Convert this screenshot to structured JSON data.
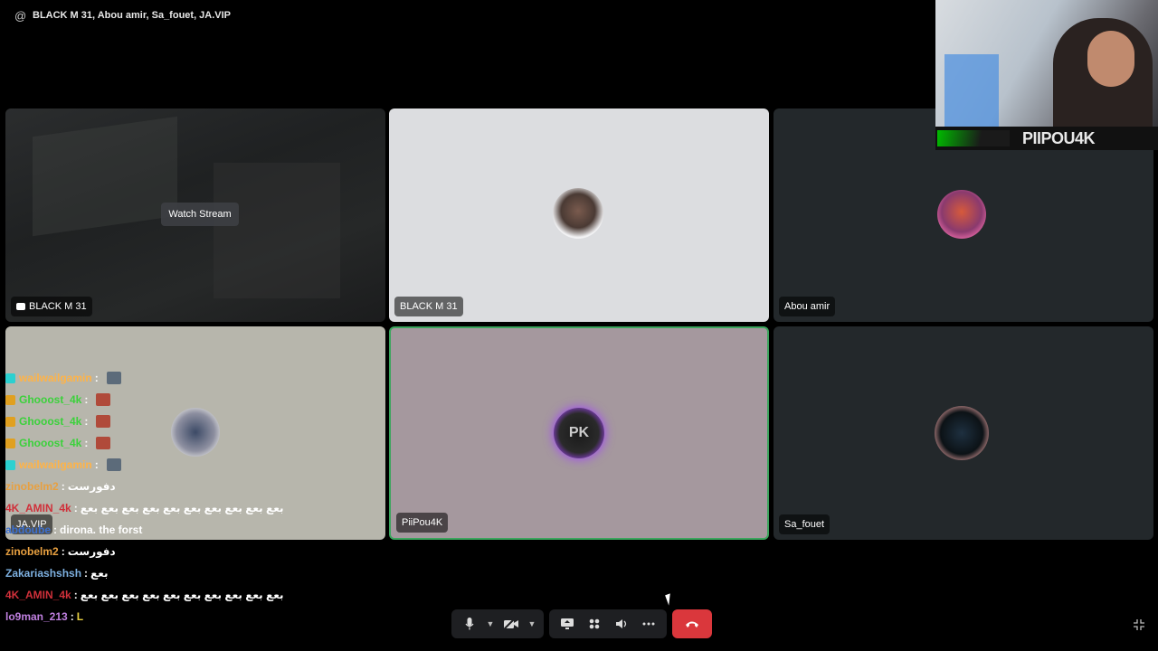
{
  "header": {
    "icon": "at-icon",
    "at_symbol": "@",
    "title": "BLACK M 31, Abou amir, Sa_fouet, JA.VIP"
  },
  "tiles": {
    "stream": {
      "name": "BLACK M 31",
      "watch_label": "Watch Stream"
    },
    "black": {
      "name": "BLACK M 31"
    },
    "abou": {
      "name": "Abou amir"
    },
    "javip": {
      "name": "JA.VIP"
    },
    "piipou": {
      "name": "PiiPou4K",
      "avatar_text": "PK"
    },
    "sa": {
      "name": "Sa_fouet"
    }
  },
  "webcam": {
    "brand": "PIIPOU4K"
  },
  "chat": {
    "lines": [
      {
        "user": "wailwailgamin",
        "msg": "",
        "user_color": "#ffb347",
        "badge_color": "#2bd0d0",
        "emote_color": "#5c6b7a"
      },
      {
        "user": "Ghooost_4k",
        "msg": "",
        "user_color": "#3bd13b",
        "badge_color": "#e0a020",
        "emote_color": "#b04a3a"
      },
      {
        "user": "Ghooost_4k",
        "msg": "",
        "user_color": "#3bd13b",
        "badge_color": "#e0a020",
        "emote_color": "#b04a3a"
      },
      {
        "user": "Ghooost_4k",
        "msg": "",
        "user_color": "#3bd13b",
        "badge_color": "#e0a020",
        "emote_color": "#b04a3a"
      },
      {
        "user": "wailwailgamin",
        "msg": "",
        "user_color": "#ffb347",
        "badge_color": "#2bd0d0",
        "emote_color": "#5c6b7a"
      },
      {
        "user": "zinobelm2",
        "msg": "دفورست",
        "user_color": "#e8a040"
      },
      {
        "user": "4K_AMIN_4k",
        "msg": "بعع بعع بعع بعع بعع بعع بعع بعع بعع بعع",
        "user_color": "#d0303a"
      },
      {
        "user": "abdoube",
        "msg": "dirona. the forst",
        "user_color": "#3b6fd0"
      },
      {
        "user": "zinobelm2",
        "msg": "دفورست",
        "user_color": "#e8a040"
      },
      {
        "user": "Zakariashshsh",
        "msg": "بعع",
        "user_color": "#7db0e0"
      },
      {
        "user": "4K_AMIN_4k",
        "msg": "بعع بعع بعع بعع بعع بعع بعع بعع بعع بعع",
        "user_color": "#d0303a"
      },
      {
        "user": "lo9man_213",
        "msg": "L",
        "user_color": "#c080e0",
        "msg_color": "#e8d040"
      }
    ]
  },
  "controls": {
    "mic": "microphone-icon",
    "mic_menu": "chevron-down-icon",
    "camera": "camera-off-icon",
    "camera_menu": "chevron-down-icon",
    "screen": "screen-share-icon",
    "activities": "activities-icon",
    "soundboard": "soundboard-icon",
    "more": "more-icon",
    "hangup": "hang-up-icon",
    "fullscreen": "fullscreen-exit-icon"
  },
  "colors": {
    "speaking_border": "#3ba55d",
    "hangup": "#da373c",
    "bar_bg": "#1e1f22"
  }
}
